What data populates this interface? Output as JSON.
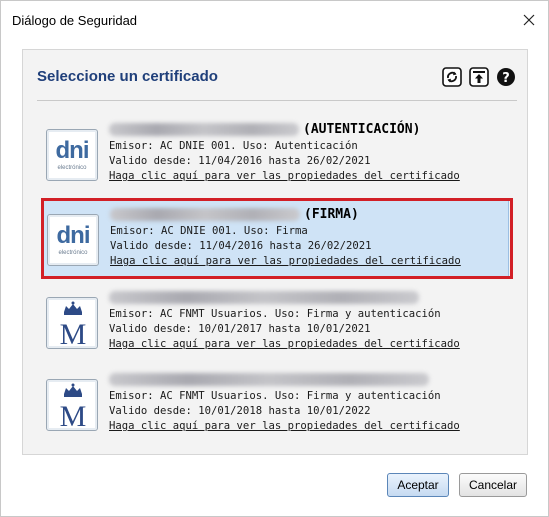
{
  "window": {
    "title": "Diálogo de Seguridad"
  },
  "header": {
    "title": "Seleccione un certificado"
  },
  "icons": {
    "refresh": "refresh-icon",
    "export": "export-icon",
    "help": "help-icon",
    "close": "close-icon"
  },
  "certificates": [
    {
      "name_suffix": "(AUTENTICACIÓN)",
      "issuer": "Emisor: AC DNIE 001. Uso: Autenticación",
      "validity": "Valido desde: 11/04/2016 hasta 26/02/2021",
      "link": "Haga clic aquí para ver las propiedades del certificado",
      "logo": "dni",
      "selected": false
    },
    {
      "name_suffix": "(FIRMA)",
      "issuer": "Emisor: AC DNIE 001. Uso: Firma",
      "validity": "Valido desde: 11/04/2016 hasta 26/02/2021",
      "link": "Haga clic aquí para ver las propiedades del certificado",
      "logo": "dni",
      "selected": true
    },
    {
      "name_suffix": "",
      "issuer": "Emisor: AC FNMT Usuarios. Uso: Firma y autenticación",
      "validity": "Valido desde: 10/01/2017 hasta 10/01/2021",
      "link": "Haga clic aquí para ver las propiedades del certificado",
      "logo": "fnmt",
      "selected": false
    },
    {
      "name_suffix": "",
      "issuer": "Emisor: AC FNMT Usuarios. Uso: Firma y autenticación",
      "validity": "Valido desde: 10/01/2018 hasta 10/01/2022",
      "link": "Haga clic aquí para ver las propiedades del certificado",
      "logo": "fnmt",
      "selected": false
    }
  ],
  "logos": {
    "dni": {
      "text": "dni",
      "subtext": "electrónico"
    }
  },
  "buttons": {
    "accept": "Aceptar",
    "cancel": "Cancelar"
  },
  "colors": {
    "header_title": "#1f3f7a",
    "selection_bg": "#cfe3f6",
    "highlight_frame": "#d21f26"
  }
}
